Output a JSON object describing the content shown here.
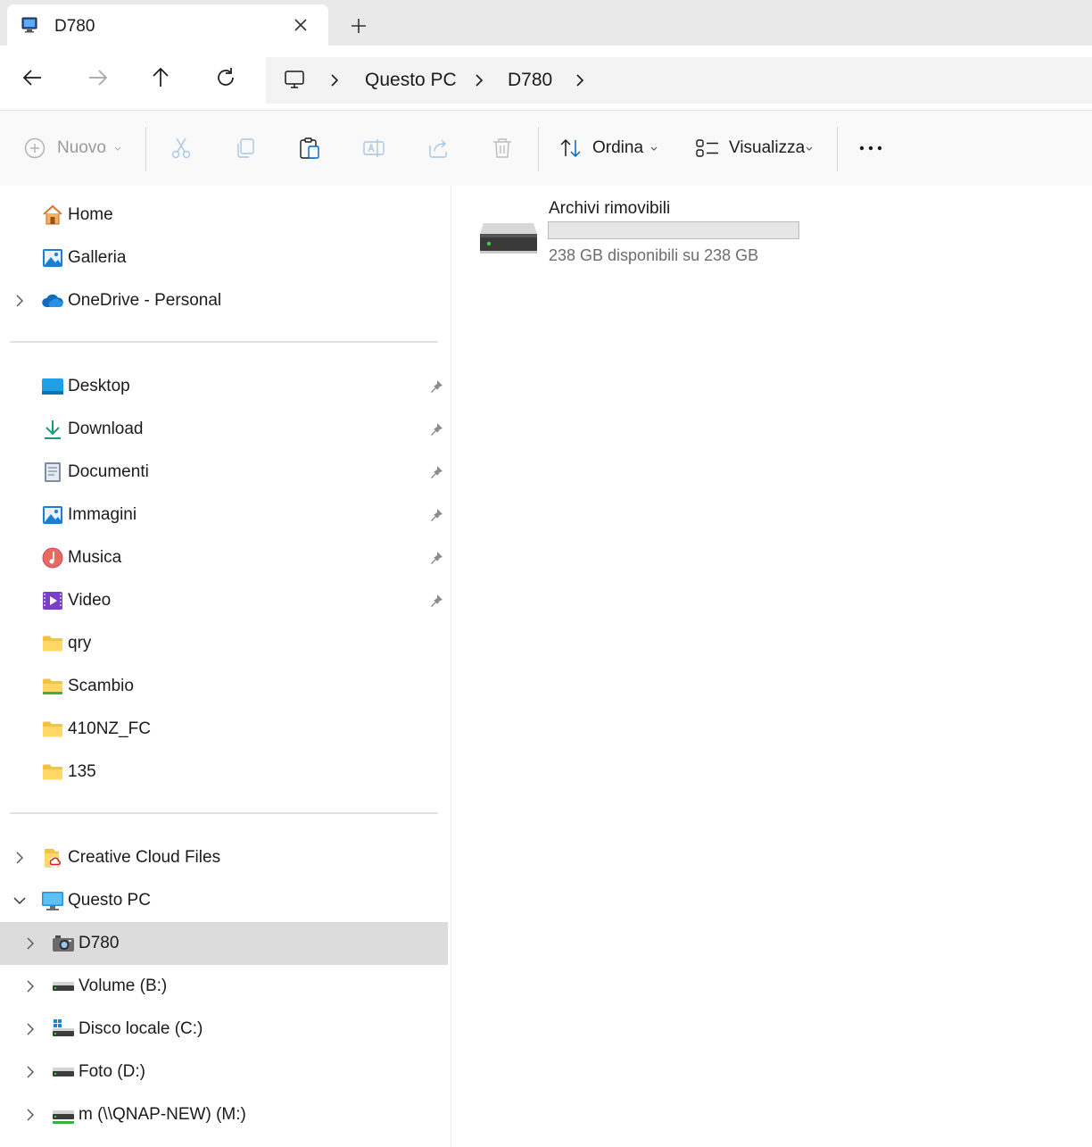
{
  "window": {
    "tab_title": "D780",
    "tab_icon": "computer-icon"
  },
  "navigation": {
    "breadcrumb": [
      "Questo PC",
      "D780"
    ]
  },
  "toolbar": {
    "new_label": "Nuovo",
    "sort_label": "Ordina",
    "view_label": "Visualizza"
  },
  "sidebar": {
    "quick": [
      {
        "label": "Home",
        "icon": "home-icon"
      },
      {
        "label": "Galleria",
        "icon": "gallery-icon"
      },
      {
        "label": "OneDrive - Personal",
        "icon": "onedrive-cloud-icon"
      }
    ],
    "pinned": [
      {
        "label": "Desktop",
        "icon": "desktop-folder-icon"
      },
      {
        "label": "Download",
        "icon": "download-icon"
      },
      {
        "label": "Documenti",
        "icon": "documents-icon"
      },
      {
        "label": "Immagini",
        "icon": "pictures-icon"
      },
      {
        "label": "Musica",
        "icon": "music-icon"
      },
      {
        "label": "Video",
        "icon": "video-icon"
      },
      {
        "label": "qry",
        "icon": "folder-icon"
      },
      {
        "label": "Scambio",
        "icon": "folder-icon"
      },
      {
        "label": "410NZ_FC",
        "icon": "folder-icon"
      },
      {
        "label": "135",
        "icon": "folder-icon"
      }
    ],
    "tree": [
      {
        "label": "Creative Cloud Files",
        "icon": "creative-cloud-folder-icon"
      },
      {
        "label": "Questo PC",
        "icon": "this-pc-icon"
      },
      {
        "label": "D780",
        "icon": "camera-icon",
        "selected": true
      },
      {
        "label": "Volume (B:)",
        "icon": "drive-icon"
      },
      {
        "label": "Disco locale (C:)",
        "icon": "windows-drive-icon"
      },
      {
        "label": "Foto (D:)",
        "icon": "drive-icon"
      },
      {
        "label": "m (\\\\QNAP-NEW) (M:)",
        "icon": "network-drive-icon"
      }
    ]
  },
  "content": {
    "drive": {
      "name": "Archivi rimovibili",
      "usage_fraction": 0.0,
      "free_text": "238 GB disponibili su 238 GB"
    }
  },
  "colors": {
    "accent": "#0067c0",
    "selected_row": "#dcdcdc",
    "tab_strip": "#e9e9e9",
    "toolbar_bg": "#f9f9f9"
  }
}
